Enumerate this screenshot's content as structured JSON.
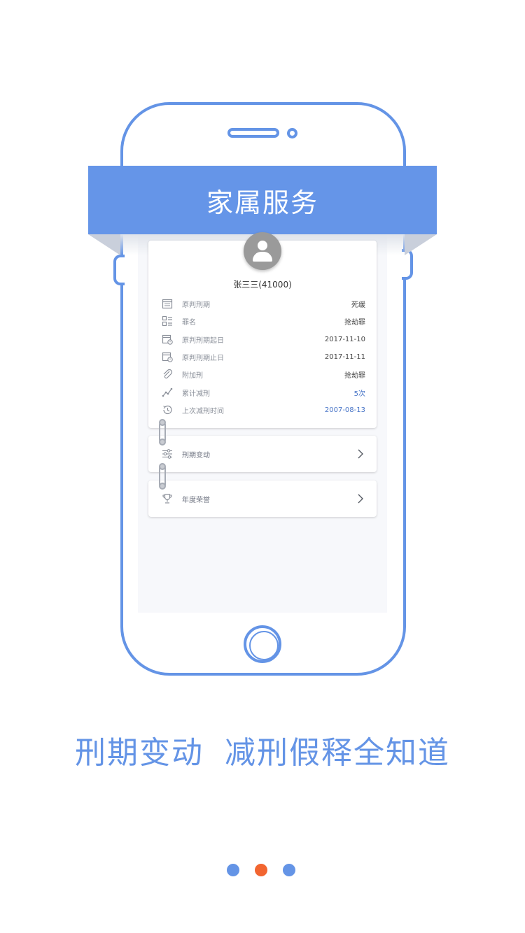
{
  "banner": {
    "title": "家属服务"
  },
  "profile": {
    "name": "张三三(41000)",
    "rows": [
      {
        "icon": "calendar-icon",
        "label": "原判刑期",
        "value": "死缓",
        "accent": false
      },
      {
        "icon": "list-icon",
        "label": "罪名",
        "value": "抢劫罪",
        "accent": false
      },
      {
        "icon": "calendar-clock-icon",
        "label": "原判刑期起日",
        "value": "2017-11-10",
        "accent": false
      },
      {
        "icon": "calendar-clock-icon",
        "label": "原判刑期止日",
        "value": "2017-11-11",
        "accent": false
      },
      {
        "icon": "paperclip-icon",
        "label": "附加刑",
        "value": "抢劫罪",
        "accent": false
      },
      {
        "icon": "trend-icon",
        "label": "累计减刑",
        "value": "5次",
        "accent": true
      },
      {
        "icon": "history-icon",
        "label": "上次减刑时间",
        "value": "2007-08-13",
        "accent": true
      }
    ]
  },
  "links": [
    {
      "icon": "sliders-icon",
      "label": "刑期变动"
    },
    {
      "icon": "trophy-icon",
      "label": "年度荣誉"
    }
  ],
  "headline": {
    "part1": "刑期变动",
    "part2": "减刑假释全知道"
  },
  "pager": {
    "dots": [
      {
        "color": "#6494e6",
        "active": false
      },
      {
        "color": "#f26530",
        "active": true
      },
      {
        "color": "#6494e6",
        "active": false
      }
    ]
  },
  "colors": {
    "accent": "#6494e6",
    "banner": "#6595e8",
    "active_dot": "#f26530"
  }
}
